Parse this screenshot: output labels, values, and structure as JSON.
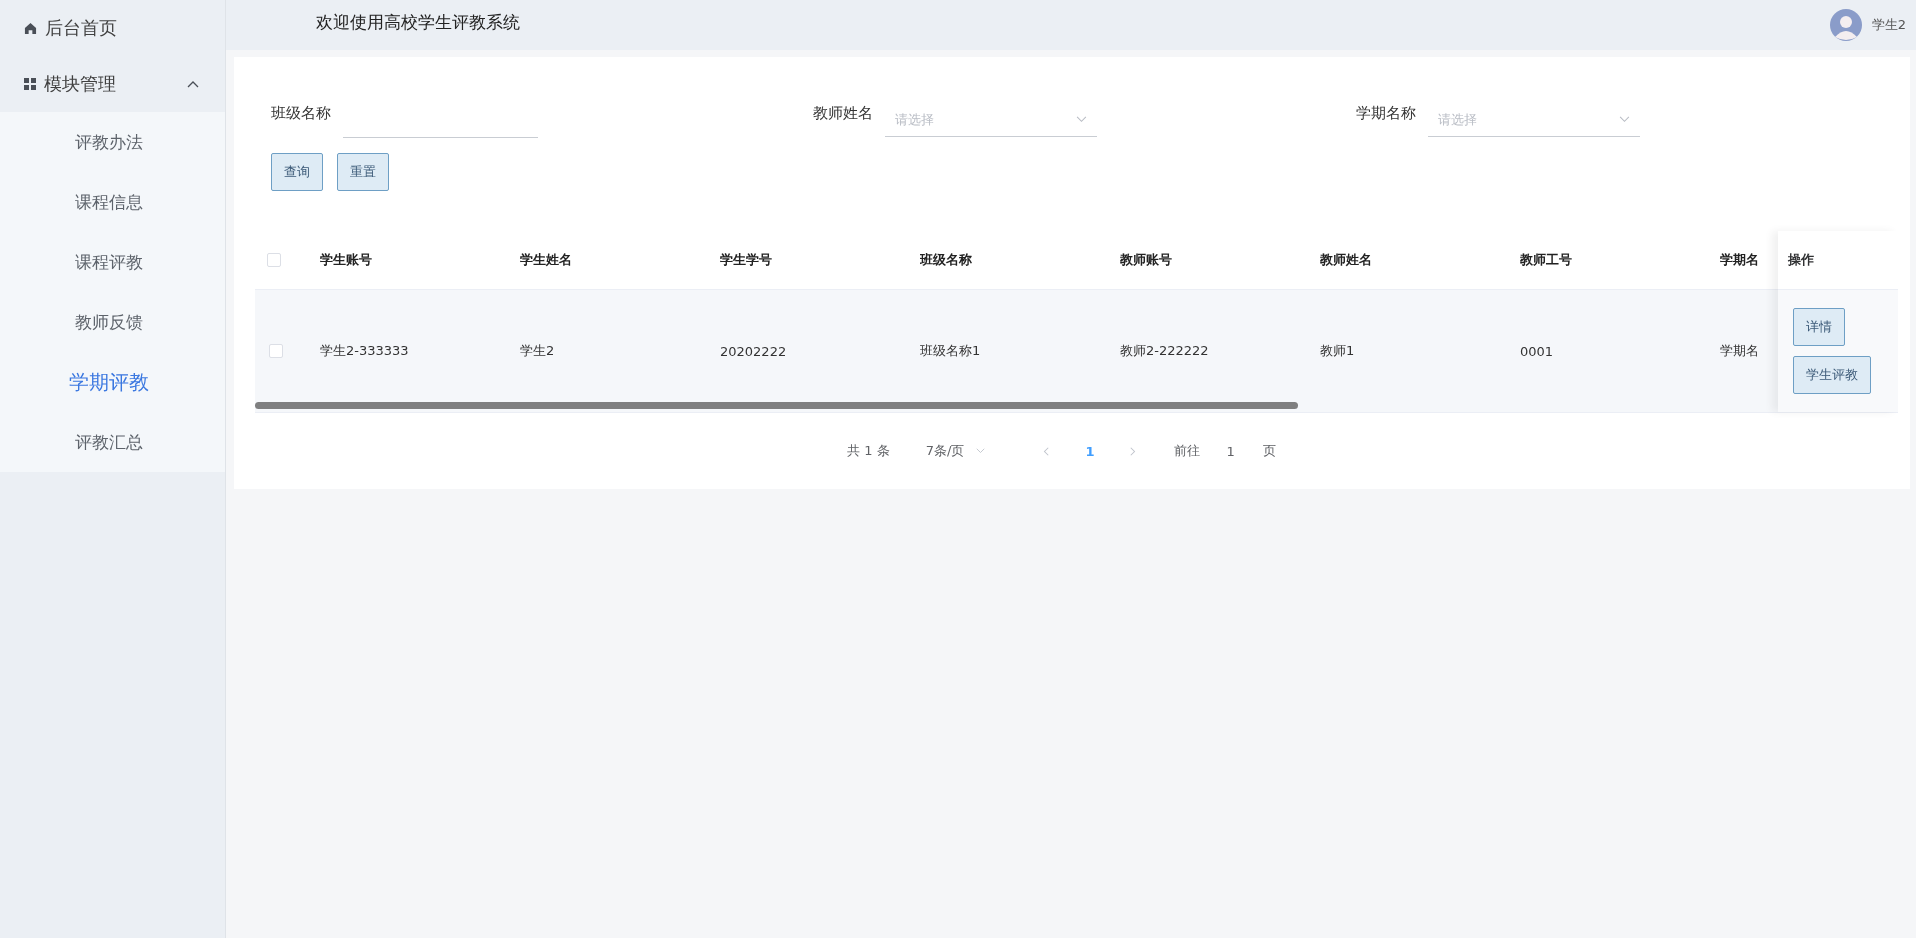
{
  "sidebar": {
    "items": [
      {
        "label": "后台首页",
        "kind": "link"
      },
      {
        "label": "模块管理",
        "kind": "group",
        "expanded": true,
        "children": [
          {
            "label": "评教办法",
            "selected": false
          },
          {
            "label": "课程信息",
            "selected": false
          },
          {
            "label": "课程评教",
            "selected": false
          },
          {
            "label": "教师反馈",
            "selected": false
          },
          {
            "label": "学期评教",
            "selected": true
          },
          {
            "label": "评教汇总",
            "selected": false
          }
        ]
      }
    ]
  },
  "header": {
    "title": "欢迎使用高校学生评教系统",
    "user": "学生2"
  },
  "filters": [
    {
      "label": "班级名称",
      "kind": "input"
    },
    {
      "label": "教师姓名",
      "kind": "select",
      "placeholder": "请选择"
    },
    {
      "label": "学期名称",
      "kind": "select",
      "placeholder": "请选择"
    }
  ],
  "buttons": [
    "查询",
    "重置"
  ],
  "table": {
    "select_all_checked": false,
    "columns": [
      "学生账号",
      "学生姓名",
      "学生学号",
      "班级名称",
      "教师账号",
      "教师姓名",
      "教师工号",
      "学期名"
    ],
    "rows": [
      {
        "checked": false,
        "cells": [
          "学生2-333333",
          "学生2",
          "20202222",
          "班级名称1",
          "教师2-222222",
          "教师1",
          "0001",
          "学期名"
        ],
        "actions": [
          "详情",
          "学生评教"
        ]
      }
    ],
    "action_header": "操作"
  },
  "pagination": {
    "total": "共 1 条",
    "page_size": "7条/页",
    "pages": [
      {
        "label": "1",
        "selected": true
      }
    ],
    "goto_label": "前往",
    "goto_value": "1",
    "goto_suffix": "页"
  }
}
